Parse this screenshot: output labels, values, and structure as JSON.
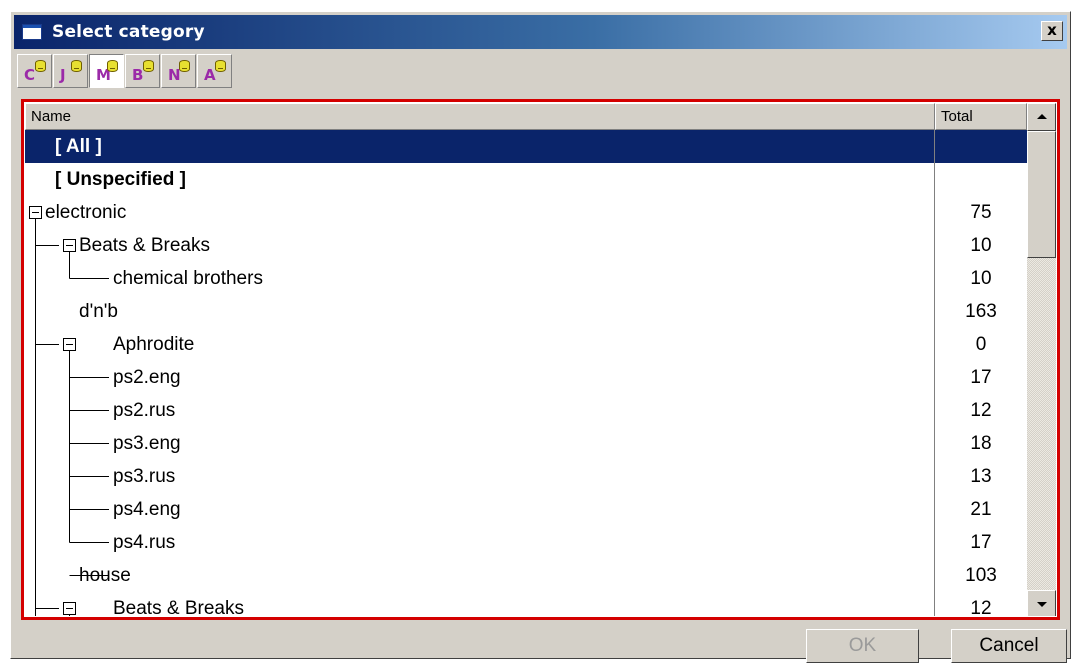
{
  "window": {
    "title": "Select category",
    "close_label": "x"
  },
  "toolbar": {
    "buttons": [
      {
        "letter": "C",
        "active": false
      },
      {
        "letter": "J",
        "active": false
      },
      {
        "letter": "M",
        "active": true
      },
      {
        "letter": "B",
        "active": false
      },
      {
        "letter": "N",
        "active": false
      },
      {
        "letter": "A",
        "active": false
      }
    ]
  },
  "list": {
    "columns": [
      "Name",
      "Total"
    ],
    "rows": [
      {
        "label": "[ All ]",
        "total": "",
        "bold": true,
        "selected": true
      },
      {
        "label": "[ Unspecified ]",
        "total": "",
        "bold": true,
        "selected": false
      },
      {
        "label": "electronic",
        "total": "75",
        "level": 0,
        "expander": "minus"
      },
      {
        "label": "Beats & Breaks",
        "total": "10",
        "level": 1,
        "expander": "minus"
      },
      {
        "label": "chemical brothers",
        "total": "10",
        "level": 2
      },
      {
        "label": "d'n'b",
        "total": "163",
        "level": 1,
        "expander": "minus"
      },
      {
        "label": "Aphrodite",
        "total": "0",
        "level": 2
      },
      {
        "label": "ps2.eng",
        "total": "17",
        "level": 2
      },
      {
        "label": "ps2.rus",
        "total": "12",
        "level": 2
      },
      {
        "label": "ps3.eng",
        "total": "18",
        "level": 2
      },
      {
        "label": "ps3.rus",
        "total": "13",
        "level": 2
      },
      {
        "label": "ps4.eng",
        "total": "21",
        "level": 2
      },
      {
        "label": "ps4.rus",
        "total": "17",
        "level": 2
      },
      {
        "label": "house",
        "total": "103",
        "level": 1,
        "expander": "minus"
      },
      {
        "label": "Beats & Breaks",
        "total": "12",
        "level": 2
      }
    ]
  },
  "buttons": {
    "ok_label": "OK",
    "cancel_label": "Cancel"
  }
}
